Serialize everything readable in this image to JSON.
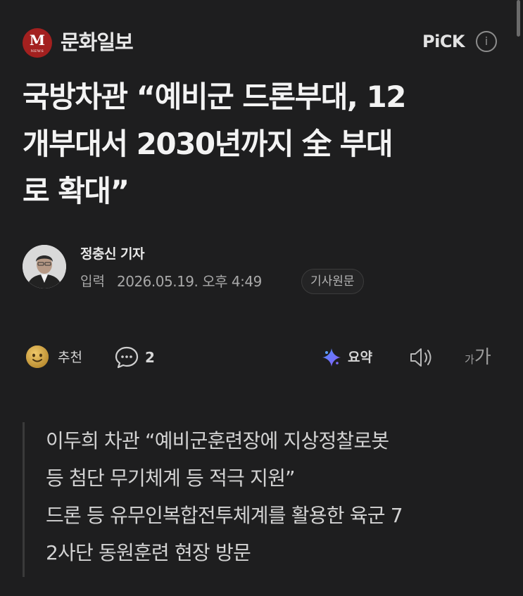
{
  "press": {
    "logo_letter": "M",
    "logo_sub": "NEWS",
    "name": "문화일보",
    "pick_label": "PiCK",
    "pick_info_symbol": "i",
    "brand_color": "#a3201f"
  },
  "article": {
    "title_lines": [
      "국방차관 “예비군 드론부대, 12",
      "개부대서 2030년까지 全 부대",
      "로 확대”"
    ],
    "reporter": "정충신 기자",
    "input_label": "입력",
    "input_datetime": "2026.05.19. 오후 4:49",
    "original_link_label": "기사원문"
  },
  "actions": {
    "recommend_label": "추천",
    "comment_count": "2",
    "summary_label": "요약",
    "tts_icon": "speaker-icon",
    "font_small": "가",
    "font_big": "가"
  },
  "summary": {
    "lines": [
      "이두희 차관 “예비군훈련장에 지상정찰로봇",
      "등 첨단 무기체계 등 적극 지원”",
      "드론 등 유무인복합전투체계를 활용한 육군 7",
      "2사단 동원훈련 현장 방문"
    ]
  }
}
